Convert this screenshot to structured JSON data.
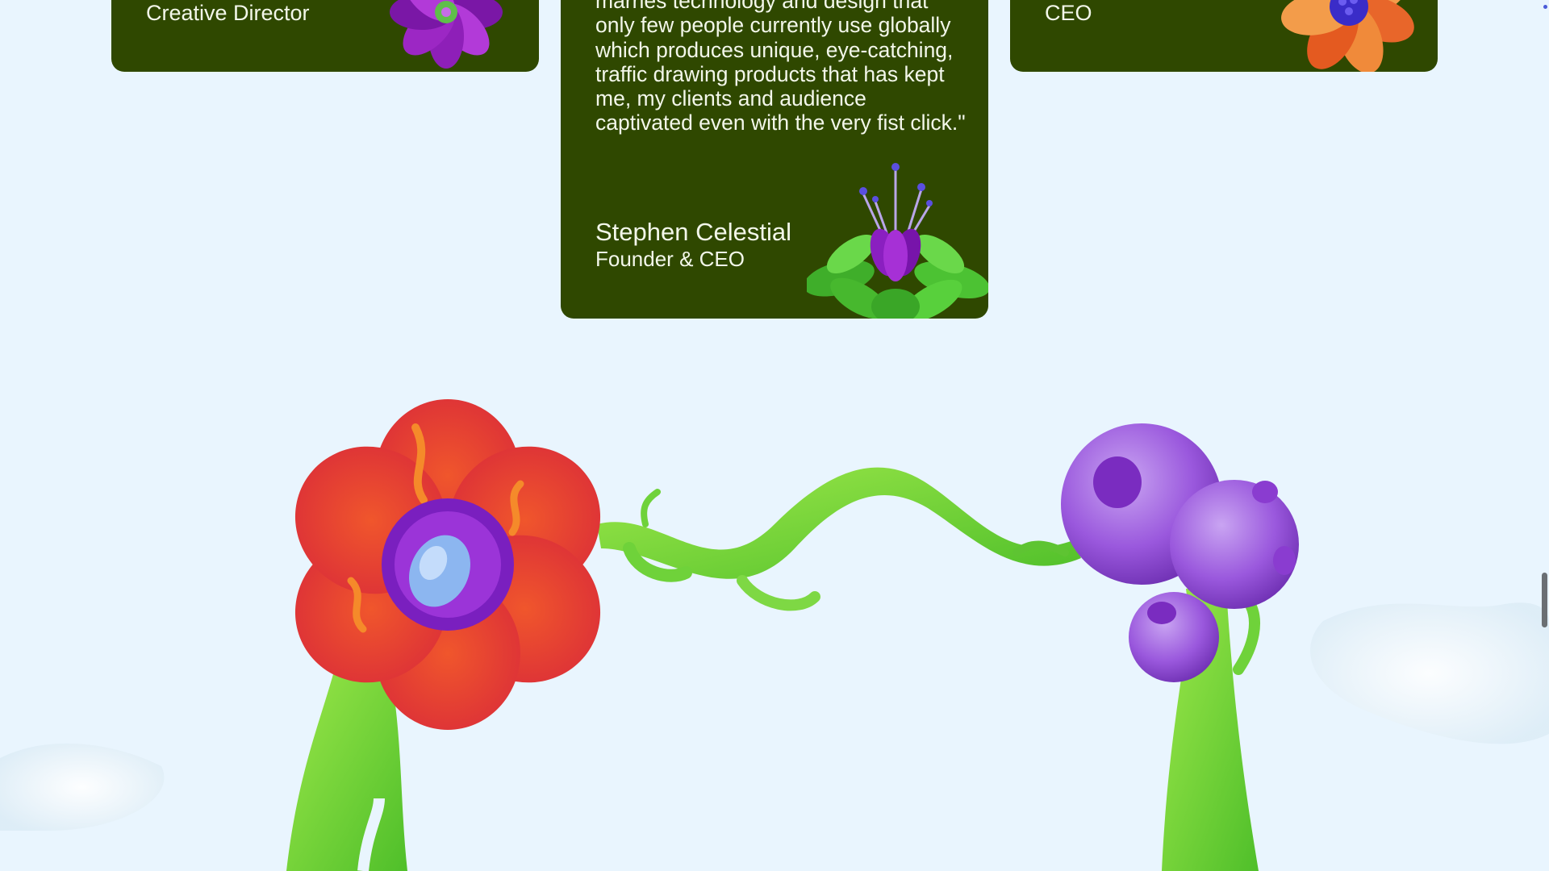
{
  "testimonials": {
    "left": {
      "role": "Creative Director"
    },
    "center": {
      "quote": "marries technology and design that only few people currently use globally which produces unique, eye-catching, traffic drawing products that has kept me, my clients and audience captivated even with the very fist click.\"",
      "author_name": "Stephen Celestial",
      "author_role": "Founder & CEO"
    },
    "right": {
      "role": "CEO"
    }
  },
  "colors": {
    "page_background": "#e9f5fe",
    "card_background": "#2f4800",
    "card_text": "#f3f7ea"
  },
  "decorations": {
    "left_card_icon": "purple-flower-icon",
    "right_card_icon": "orange-flower-icon",
    "center_card_icon": "green-lotus-flower-icon",
    "hero_art": "flower-vine-arch-illustration"
  }
}
